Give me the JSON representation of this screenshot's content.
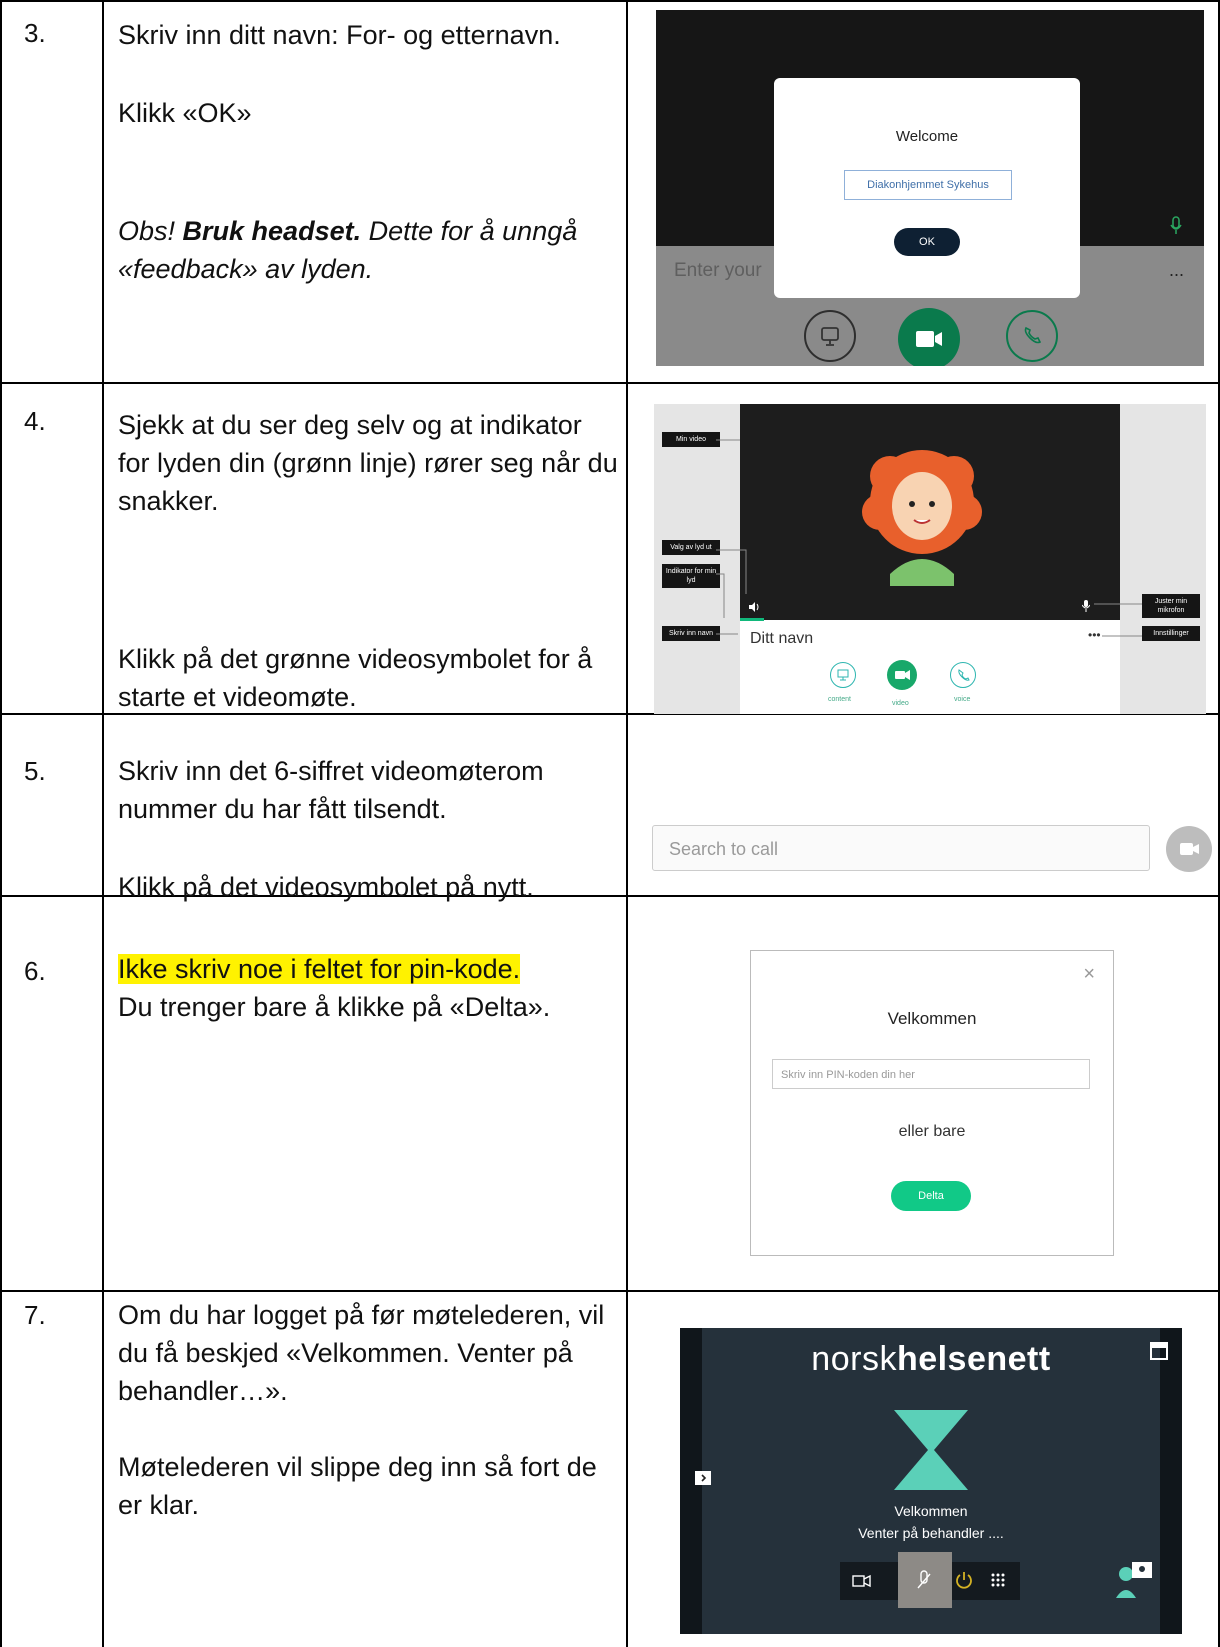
{
  "rows": [
    {
      "num": "3.",
      "lines": [
        "Skriv inn ditt navn: For- og etternavn.",
        "Klikk «OK»"
      ],
      "note_prefix": "Obs! ",
      "note_bold": "Bruk headset.",
      "note_rest": " Dette for å unngå «feedback» av lyden."
    },
    {
      "num": "4.",
      "para1": "Sjekk at du ser deg selv og at indikator for lyden din (grønn linje) rører seg når du snakker.",
      "para2": "Klikk på det grønne videosymbolet for å starte et videomøte."
    },
    {
      "num": "5.",
      "para1": "Skriv inn det 6-siffret videomøterom nummer du har fått tilsendt.",
      "para2": "Klikk på det videosymbolet på nytt."
    },
    {
      "num": "6.",
      "highlight": "Ikke skriv noe i feltet for pin-kode.",
      "rest": "Du trenger bare å klikke på «Delta»."
    },
    {
      "num": "7.",
      "para1": "Om du har logget på før møtelederen, vil du få beskjed «Velkommen. Venter på behandler…».",
      "para2": "Møtelederen vil slippe deg inn så fort de er klar."
    }
  ],
  "shot3": {
    "title": "Welcome",
    "name_value": "Diakonhjemmet Sykehus",
    "ok": "OK",
    "enter": "Enter your",
    "dots": "..."
  },
  "shot4": {
    "min_video": "Min video",
    "valg": "Valg av lyd ut",
    "indikator": "Indikator for min lyd",
    "skriv": "Skriv inn navn",
    "juster": "Juster min mikrofon",
    "innst": "Innstillinger",
    "name": "Ditt navn",
    "content": "content",
    "video": "video",
    "voice": "voice"
  },
  "shot5": {
    "placeholder": "Search to call"
  },
  "shot6": {
    "close": "×",
    "title": "Velkommen",
    "pin_placeholder": "Skriv inn PIN-koden din her",
    "or": "eller bare",
    "delta": "Delta"
  },
  "shot7": {
    "logo_light": "norsk",
    "logo_bold": "helsenett",
    "line1": "Velkommen",
    "line2": "Venter på behandler ...."
  }
}
